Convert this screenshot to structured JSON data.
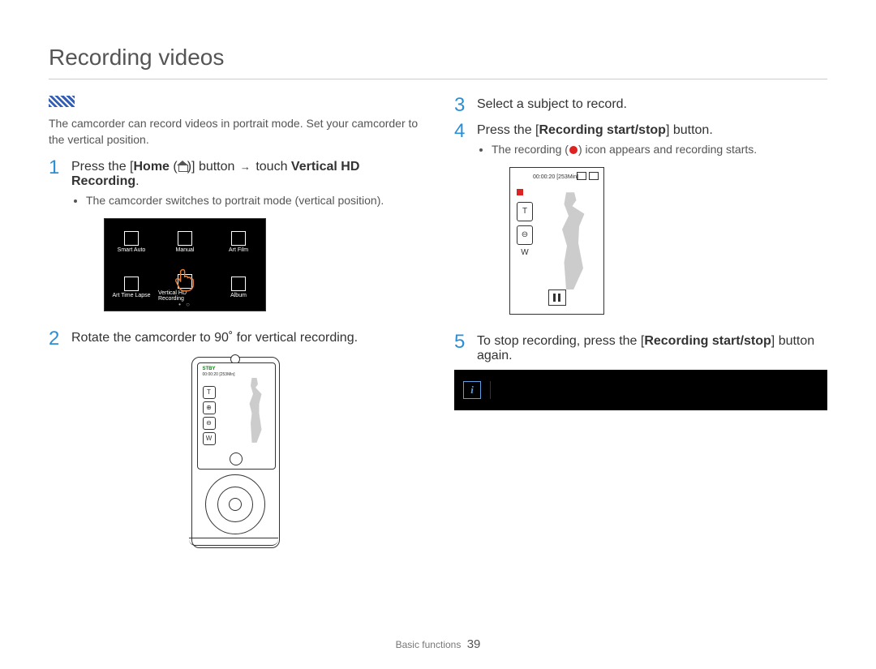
{
  "title": "Recording videos",
  "intro": "The camcorder can record videos in portrait mode. Set your camcorder to the vertical position.",
  "steps": {
    "s1": {
      "num": "1",
      "pre": "Press the [",
      "home_bold": "Home",
      "mid": " (",
      "post_icon": ")] button ",
      "touch": " touch ",
      "vhd_bold": "Vertical HD Recording",
      "end": ".",
      "bullet": "The camcorder switches to portrait mode (vertical position)."
    },
    "s2": {
      "num": "2",
      "text": "Rotate the camcorder to 90˚ for vertical recording."
    },
    "s3": {
      "num": "3",
      "text": "Select a subject to record."
    },
    "s4": {
      "num": "4",
      "pre": "Press the [",
      "btn_bold": "Recording start/stop",
      "post": "] button.",
      "bullet_pre": "The recording (",
      "bullet_post": ") icon appears and recording starts."
    },
    "s5": {
      "num": "5",
      "pre": "To stop recording, press the [",
      "btn_bold": "Recording start/stop",
      "post": "] button again."
    }
  },
  "menu": {
    "items": [
      "Smart Auto",
      "Manual",
      "Art Film",
      "Art Time Lapse",
      "Vertical HD Recording",
      "Album"
    ],
    "dots": "• ○"
  },
  "lcd": {
    "stby": "STBY",
    "time": "00:00:20 [253Min]"
  },
  "vshot": {
    "time": "00:00:20 [253Min]",
    "zoom_in_label": "T",
    "zoom_out_label": "W"
  },
  "note_text": "",
  "footer": {
    "section": "Basic functions",
    "page": "39"
  }
}
